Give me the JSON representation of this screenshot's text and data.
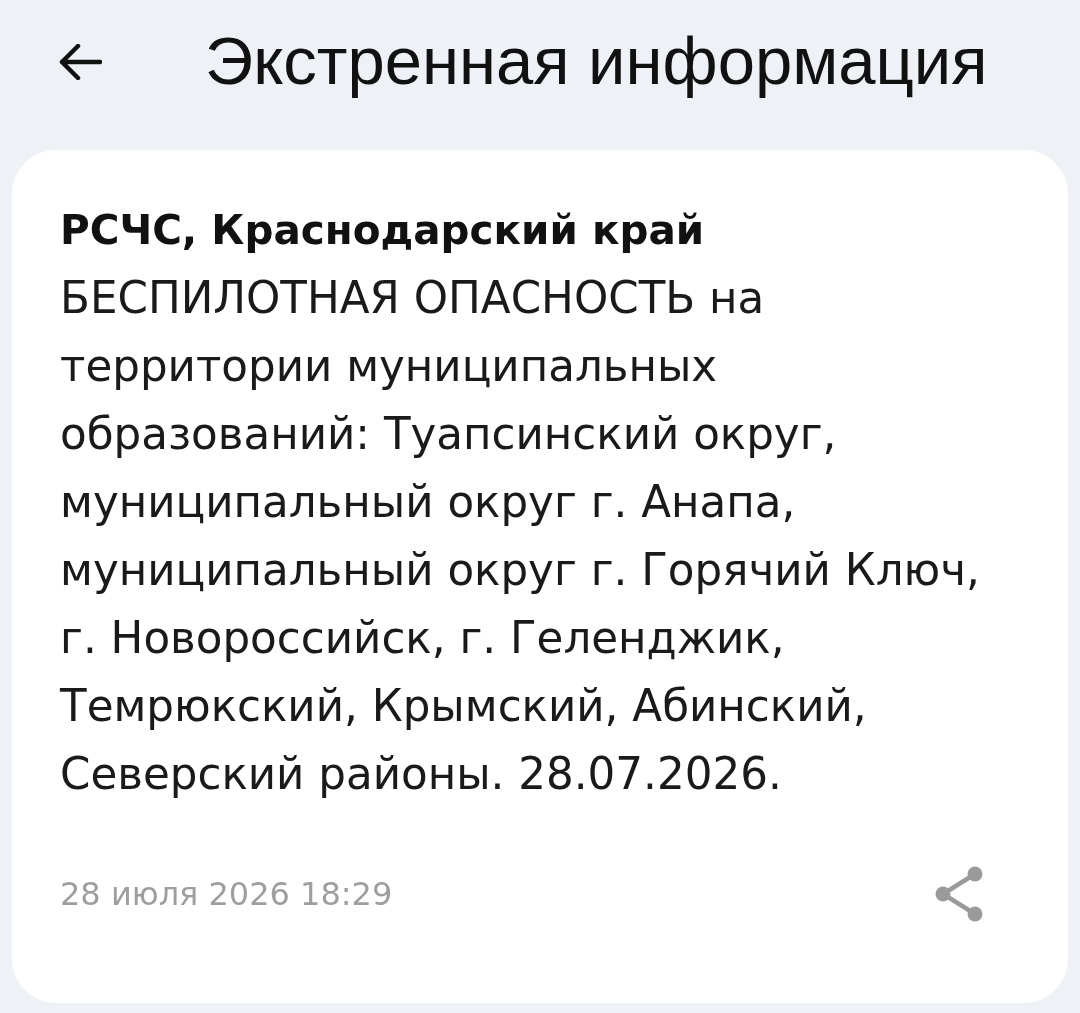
{
  "header": {
    "title": "Экстренная информация"
  },
  "alert": {
    "source": "РСЧС, Краснодарский край",
    "message": "БЕСПИЛОТНАЯ ОПАСНОСТЬ на территории муниципальных образований: Туапсинский округ, муниципальный округ г. Анапа, муниципальный округ г. Горячий Ключ, г. Новороссийск, г. Геленджик, Темрюкский, Крымский, Абинский, Северский районы. 28.07.2026.",
    "timestamp": "28 июля 2026 18:29"
  }
}
